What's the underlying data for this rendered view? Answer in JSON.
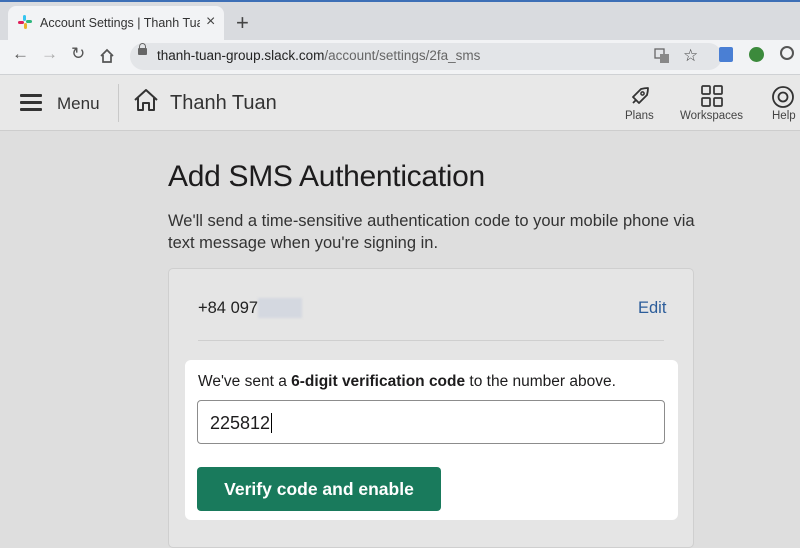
{
  "browser": {
    "tab_title": "Account Settings | Thanh Tuan Sl",
    "url_domain": "thanh-tuan-group.slack.com",
    "url_path": "/account/settings/2fa_sms"
  },
  "header": {
    "menu_label": "Menu",
    "workspace_name": "Thanh Tuan",
    "actions": [
      "Plans",
      "Workspaces",
      "Help"
    ]
  },
  "page": {
    "title": "Add SMS Authentication",
    "description": "We'll send a time-sensitive authentication code to your mobile phone via text message when you're signing in.",
    "phone_number": "+84 097",
    "edit_label": "Edit",
    "message_prefix": "We've sent a ",
    "message_bold": "6-digit verification code",
    "message_suffix": " to the number above.",
    "code_value": "225812",
    "verify_button": "Verify code and enable"
  },
  "colors": {
    "primary_button": "#197a5c",
    "link": "#2c5d9a"
  }
}
